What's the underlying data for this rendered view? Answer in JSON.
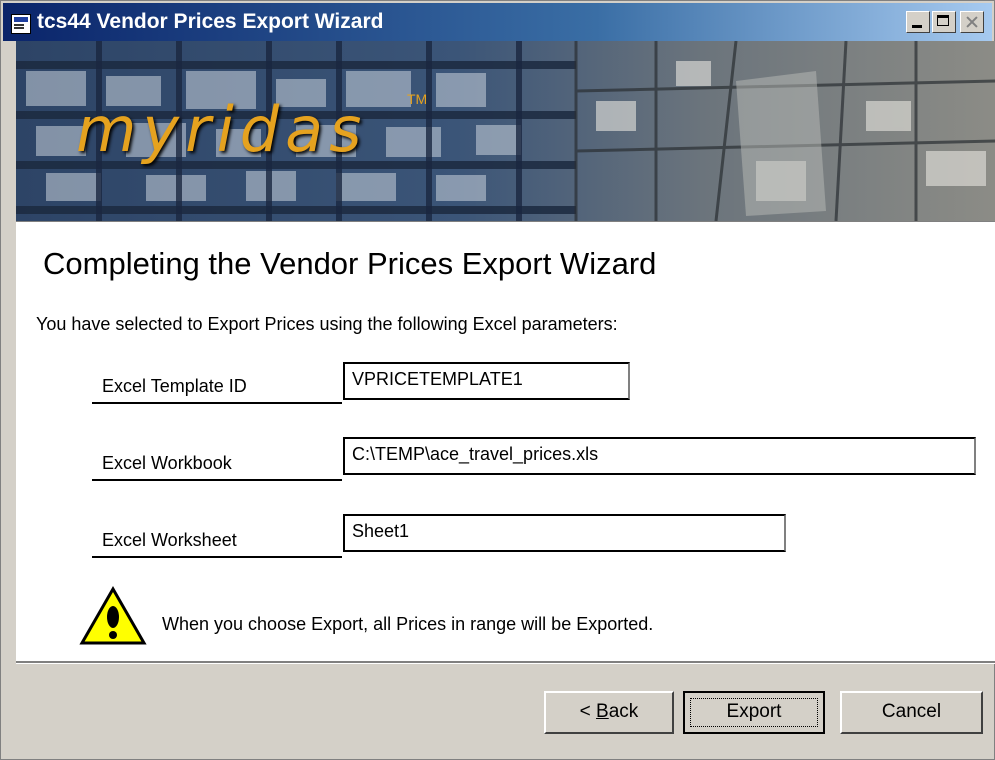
{
  "window": {
    "title": "tcs44 Vendor Prices Export Wizard"
  },
  "banner": {
    "logo_text": "myridas",
    "trademark": "TM"
  },
  "main": {
    "heading": "Completing the Vendor Prices Export Wizard",
    "intro": "You have selected to Export Prices using the following Excel parameters:",
    "fields": [
      {
        "label": "Excel Template ID",
        "value": "VPRICETEMPLATE1"
      },
      {
        "label": "Excel Workbook",
        "value": "C:\\TEMP\\ace_travel_prices.xls"
      },
      {
        "label": "Excel Worksheet",
        "value": "Sheet1"
      }
    ],
    "warning": "When you choose Export, all Prices in range will be Exported."
  },
  "footer": {
    "back_prefix": "< ",
    "back_hotkey": "B",
    "back_rest": "ack",
    "export_label": "Export",
    "cancel_label": "Cancel"
  },
  "icons": {
    "app": "wizard-window-icon",
    "warning": "warning-triangle-icon"
  },
  "colors": {
    "title_bar_start": "#0a246a",
    "title_bar_end": "#a6caf0",
    "logo": "#e5a21f",
    "warning_fill": "#ffff00"
  }
}
